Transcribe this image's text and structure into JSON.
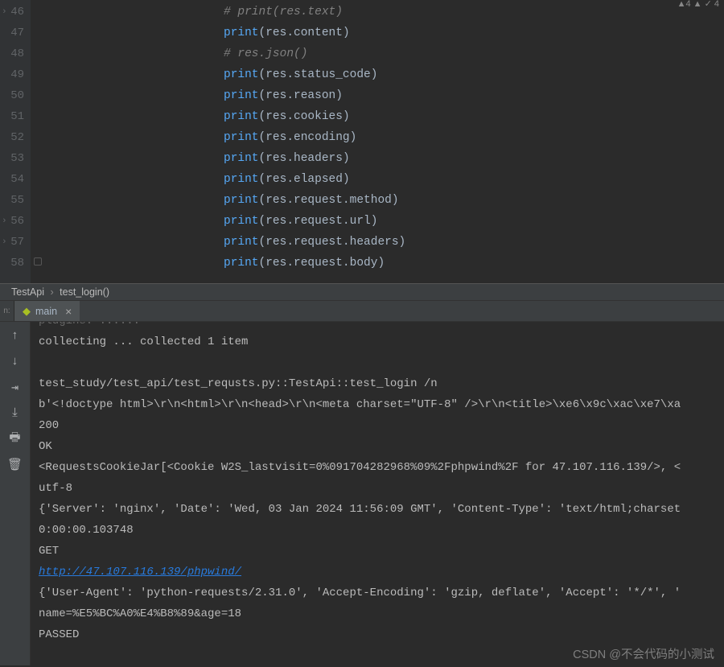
{
  "gutter": {
    "start": 46,
    "end": 58,
    "fold_chevrons": [
      46,
      56,
      57
    ]
  },
  "code": {
    "lines": [
      {
        "type": "comment",
        "text": "# print(res.text)"
      },
      {
        "type": "call",
        "fn": "print",
        "arg": "res.content"
      },
      {
        "type": "comment",
        "text": "# res.json()"
      },
      {
        "type": "call",
        "fn": "print",
        "arg": "res.status_code"
      },
      {
        "type": "call",
        "fn": "print",
        "arg": "res.reason"
      },
      {
        "type": "call",
        "fn": "print",
        "arg": "res.cookies"
      },
      {
        "type": "call",
        "fn": "print",
        "arg": "res.encoding"
      },
      {
        "type": "call",
        "fn": "print",
        "arg": "res.headers"
      },
      {
        "type": "call",
        "fn": "print",
        "arg": "res.elapsed"
      },
      {
        "type": "call",
        "fn": "print",
        "arg": "res.request.method"
      },
      {
        "type": "call",
        "fn": "print",
        "arg": "res.request.url"
      },
      {
        "type": "call",
        "fn": "print",
        "arg": "res.request.headers"
      },
      {
        "type": "call",
        "fn": "print",
        "arg": "res.request.body"
      }
    ]
  },
  "breadcrumb": {
    "class": "TestApi",
    "method": "test_login()"
  },
  "tab": {
    "label_prefix": "n:",
    "icon": "python",
    "name": "main",
    "close": "×"
  },
  "console": {
    "lines": [
      "collecting ... collected 1 item",
      "",
      "test_study/test_api/test_requsts.py::TestApi::test_login /n",
      "b'<!doctype html>\\r\\n<html>\\r\\n<head>\\r\\n<meta charset=\"UTF-8\" />\\r\\n<title>\\xe6\\x9c\\xac\\xe7\\xa",
      "200",
      "OK",
      "<RequestsCookieJar[<Cookie W2S_lastvisit=0%091704282968%09%2Fphpwind%2F for 47.107.116.139/>, <",
      "utf-8",
      "{'Server': 'nginx', 'Date': 'Wed, 03 Jan 2024 11:56:09 GMT', 'Content-Type': 'text/html;charset",
      "0:00:00.103748",
      "GET",
      {
        "link": "http://47.107.116.139/phpwind/"
      },
      "{'User-Agent': 'python-requests/2.31.0', 'Accept-Encoding': 'gzip, deflate', 'Accept': '*/*', '",
      "name=%E5%BC%A0%E4%B8%89&age=18",
      "PASSED",
      ""
    ]
  },
  "tool_icons": [
    "arrow-up",
    "arrow-down",
    "soft-wrap",
    "scroll-to-end",
    "print",
    "trash"
  ],
  "watermark": "CSDN @不会代码的小测试"
}
